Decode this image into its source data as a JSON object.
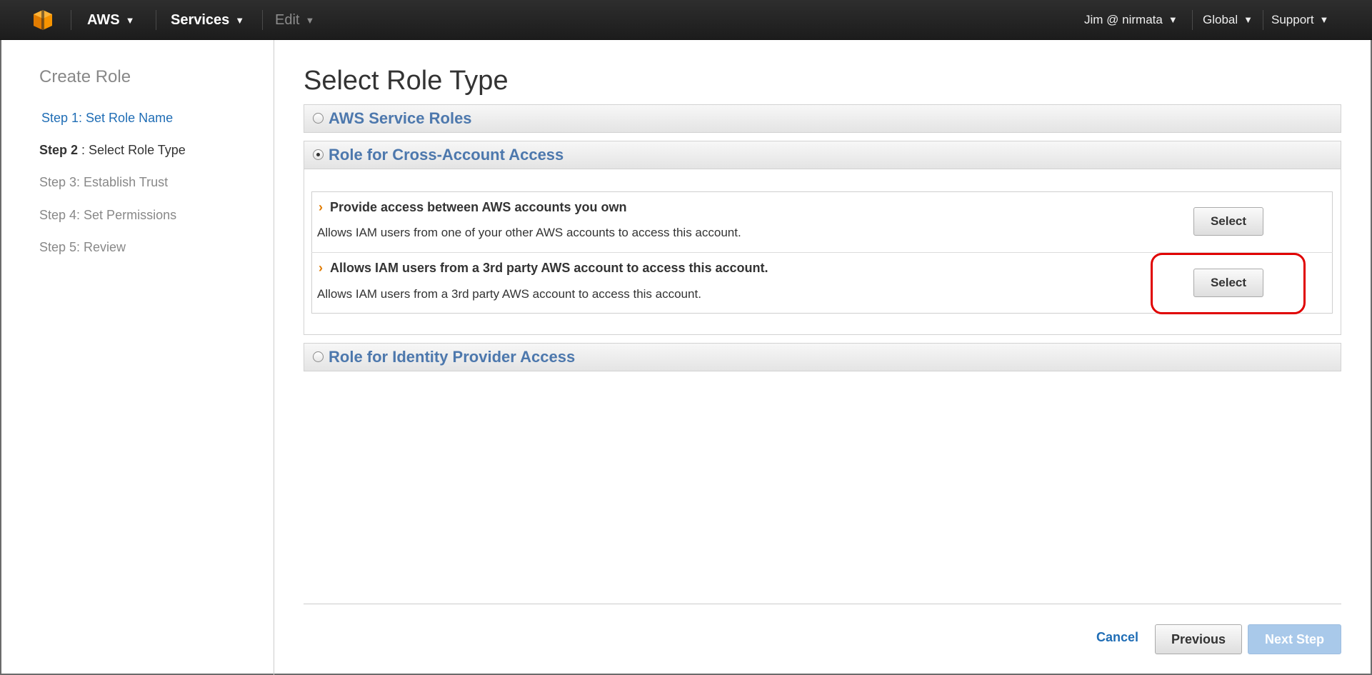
{
  "topbar": {
    "brand": "AWS",
    "services": "Services",
    "edit": "Edit",
    "user": "Jim @ nirmata",
    "region": "Global",
    "support": "Support"
  },
  "sidebar": {
    "title": "Create Role",
    "steps": [
      {
        "label": "Step 1: Set Role Name",
        "state": "link"
      },
      {
        "label_bold": "Step 2",
        "label_rest": " : Select Role Type",
        "state": "current"
      },
      {
        "label": "Step 3: Establish Trust",
        "state": "disabled"
      },
      {
        "label": "Step 4: Set Permissions",
        "state": "disabled"
      },
      {
        "label": "Step 5: Review",
        "state": "disabled"
      }
    ]
  },
  "main": {
    "title": "Select Role Type",
    "sections": [
      {
        "label": "AWS Service Roles",
        "selected": false
      },
      {
        "label": "Role for Cross-Account Access",
        "selected": true
      },
      {
        "label": "Role for Identity Provider Access",
        "selected": false
      }
    ],
    "options": [
      {
        "title": "Provide access between AWS accounts you own",
        "description": "Allows IAM users from one of your other AWS accounts to access this account.",
        "button": "Select"
      },
      {
        "title": "Allows IAM users from a 3rd party AWS account to access this account.",
        "description": "Allows IAM users from a 3rd party AWS account to access this account.",
        "button": "Select"
      }
    ]
  },
  "footer": {
    "cancel": "Cancel",
    "previous": "Previous",
    "next": "Next Step"
  },
  "colors": {
    "link": "#1f6db5",
    "section_label": "#4d78ad",
    "chevron": "#e07b00",
    "next_button_bg": "#a9c9ea",
    "highlight": "#e00000",
    "topbar": "#232323"
  },
  "icons": {
    "logo": "aws-cube-logo-icon",
    "dropdown": "caret-down-icon",
    "expand": "chevron-right-icon"
  }
}
